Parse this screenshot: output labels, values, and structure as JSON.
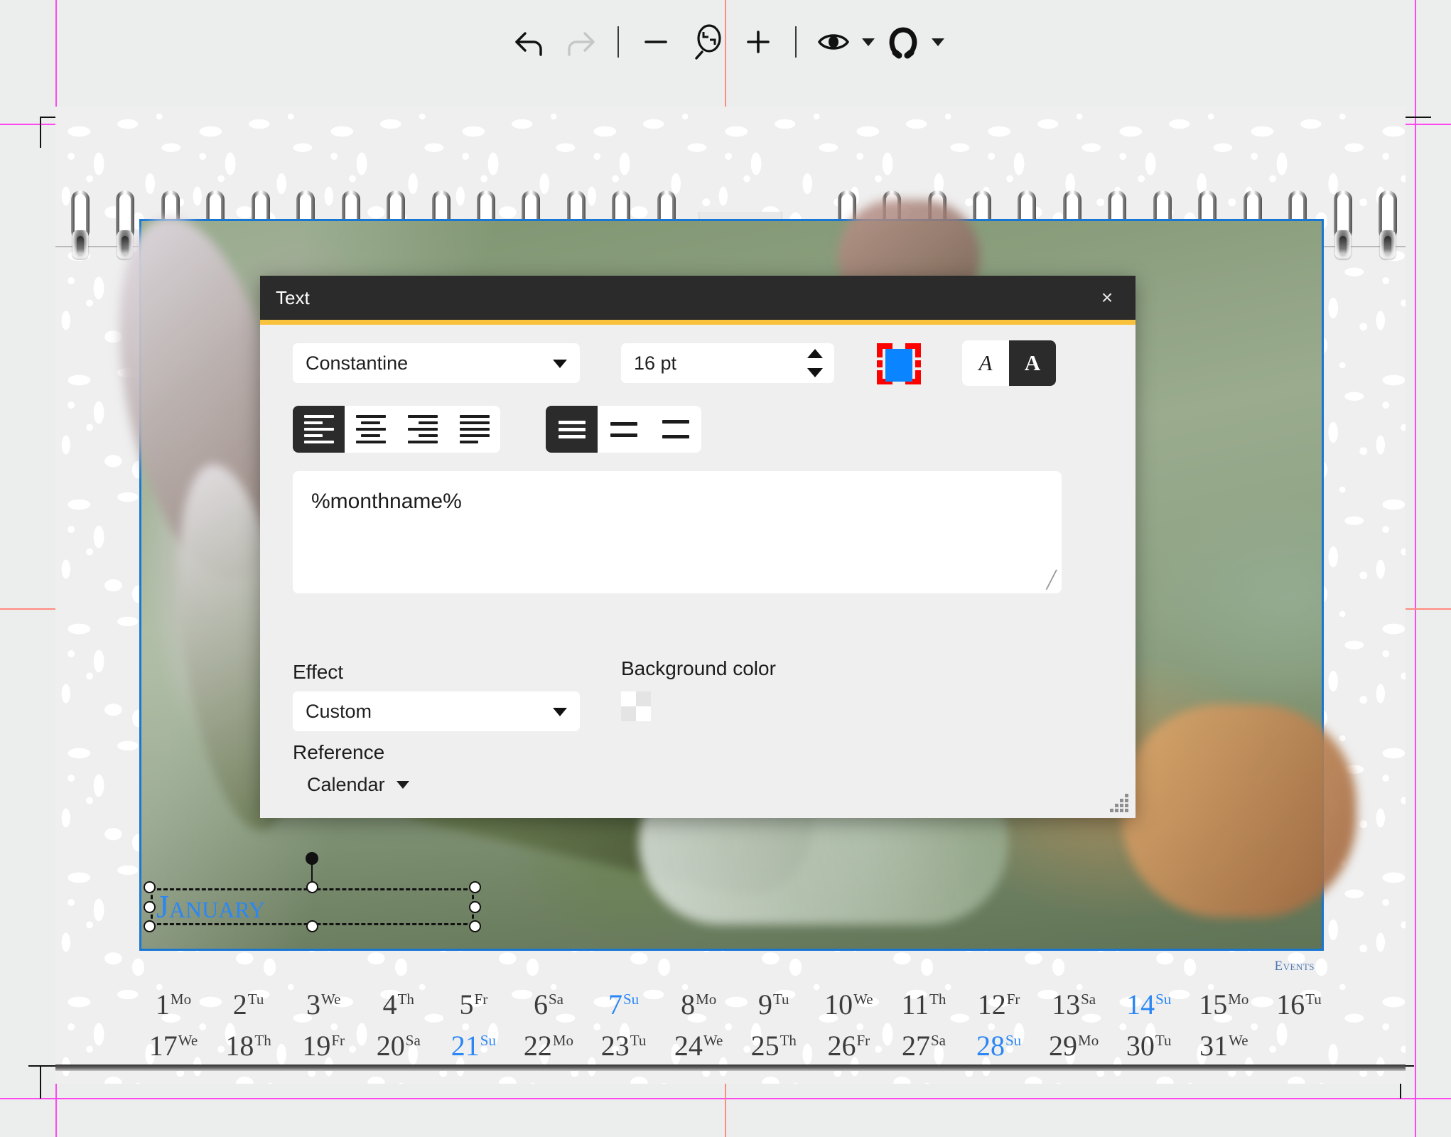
{
  "toolbar": {
    "buttons": [
      {
        "name": "undo-icon",
        "label": "Undo",
        "state": "enabled"
      },
      {
        "name": "redo-icon",
        "label": "Redo",
        "state": "disabled"
      },
      {
        "name": "zoom-out-icon",
        "label": "Zoom out",
        "state": "enabled"
      },
      {
        "name": "zoom-fit-icon",
        "label": "Zoom to fit",
        "state": "enabled"
      },
      {
        "name": "zoom-in-icon",
        "label": "Zoom in",
        "state": "enabled"
      },
      {
        "name": "preview-eye-icon",
        "label": "Preview",
        "state": "enabled"
      },
      {
        "name": "snap-magnet-icon",
        "label": "Snap",
        "state": "enabled"
      }
    ]
  },
  "dialog": {
    "title": "Text",
    "close_label": "×",
    "font": {
      "value": "Constantine"
    },
    "size": {
      "value": "16 pt"
    },
    "text_color": {
      "hex": "#0a84ff",
      "selection_hex": "#ff0000"
    },
    "style": {
      "italic_label": "A",
      "bold_label": "A",
      "active": "bold"
    },
    "alignment": {
      "options": [
        "left",
        "center",
        "right",
        "justify"
      ],
      "active": "left"
    },
    "line_spacing": {
      "options": [
        "tight",
        "medium",
        "loose"
      ],
      "active": "tight"
    },
    "content": {
      "value": "%monthname%"
    },
    "effect": {
      "label": "Effect",
      "value": "Custom"
    },
    "reference": {
      "label": "Reference",
      "value": "Calendar"
    },
    "background_color": {
      "label": "Background color",
      "value": "transparent"
    },
    "accent_hex": "#f9c23c",
    "header_hex": "#2b2b2b"
  },
  "canvas": {
    "month_title": "January",
    "events_label": "Events",
    "selected_color_hex": "#2a87f5",
    "selection_border_hex": "#1976d2",
    "guide_magenta_hex": "#ff49f0",
    "guide_red_hex": "#ff8a80"
  },
  "calendar_strip": {
    "row1": [
      {
        "day": "1",
        "wd": "Mo",
        "sunday": false
      },
      {
        "day": "2",
        "wd": "Tu",
        "sunday": false
      },
      {
        "day": "3",
        "wd": "We",
        "sunday": false
      },
      {
        "day": "4",
        "wd": "Th",
        "sunday": false
      },
      {
        "day": "5",
        "wd": "Fr",
        "sunday": false
      },
      {
        "day": "6",
        "wd": "Sa",
        "sunday": false
      },
      {
        "day": "7",
        "wd": "Su",
        "sunday": true
      },
      {
        "day": "8",
        "wd": "Mo",
        "sunday": false
      },
      {
        "day": "9",
        "wd": "Tu",
        "sunday": false
      },
      {
        "day": "10",
        "wd": "We",
        "sunday": false
      },
      {
        "day": "11",
        "wd": "Th",
        "sunday": false
      },
      {
        "day": "12",
        "wd": "Fr",
        "sunday": false
      },
      {
        "day": "13",
        "wd": "Sa",
        "sunday": false
      },
      {
        "day": "14",
        "wd": "Su",
        "sunday": true
      },
      {
        "day": "15",
        "wd": "Mo",
        "sunday": false
      },
      {
        "day": "16",
        "wd": "Tu",
        "sunday": false
      }
    ],
    "row2": [
      {
        "day": "17",
        "wd": "We",
        "sunday": false
      },
      {
        "day": "18",
        "wd": "Th",
        "sunday": false
      },
      {
        "day": "19",
        "wd": "Fr",
        "sunday": false
      },
      {
        "day": "20",
        "wd": "Sa",
        "sunday": false
      },
      {
        "day": "21",
        "wd": "Su",
        "sunday": true
      },
      {
        "day": "22",
        "wd": "Mo",
        "sunday": false
      },
      {
        "day": "23",
        "wd": "Tu",
        "sunday": false
      },
      {
        "day": "24",
        "wd": "We",
        "sunday": false
      },
      {
        "day": "25",
        "wd": "Th",
        "sunday": false
      },
      {
        "day": "26",
        "wd": "Fr",
        "sunday": false
      },
      {
        "day": "27",
        "wd": "Sa",
        "sunday": false
      },
      {
        "day": "28",
        "wd": "Su",
        "sunday": true
      },
      {
        "day": "29",
        "wd": "Mo",
        "sunday": false
      },
      {
        "day": "30",
        "wd": "Tu",
        "sunday": false
      },
      {
        "day": "31",
        "wd": "We",
        "sunday": false
      },
      {
        "day": "",
        "wd": "",
        "sunday": false
      }
    ]
  }
}
